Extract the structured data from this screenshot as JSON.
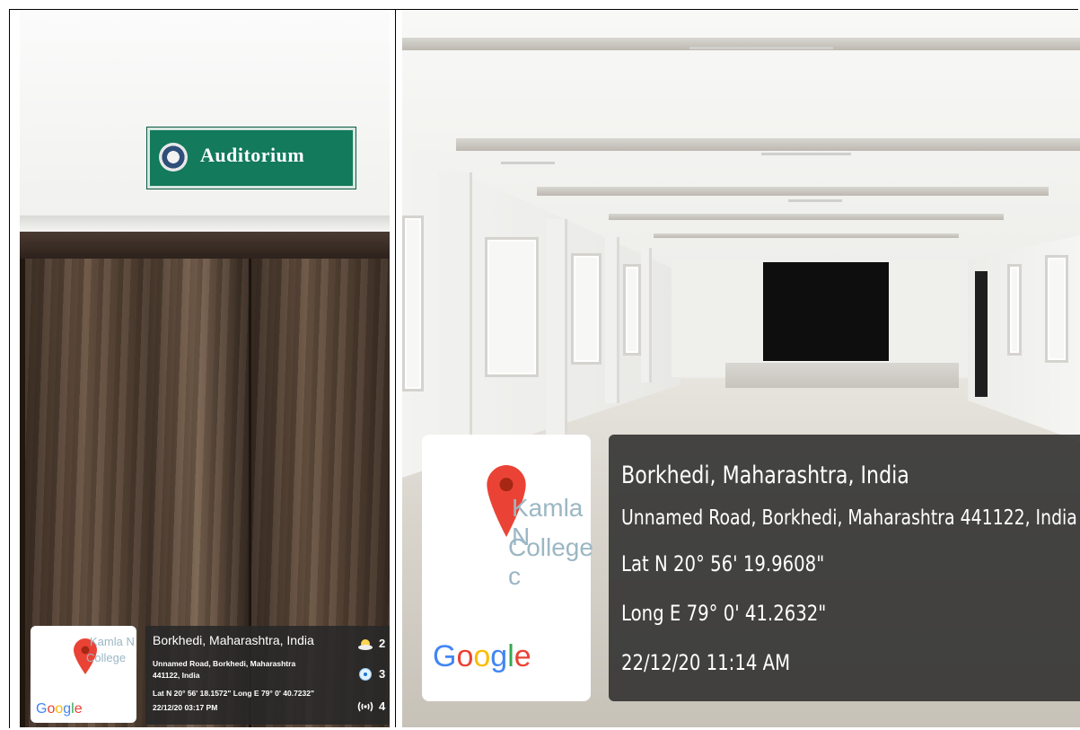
{
  "left_photo": {
    "sign_text": "Auditorium",
    "map_thumb": {
      "text_line1": "Kamla N",
      "text_line2": "College",
      "google": [
        "G",
        "o",
        "o",
        "g",
        "l",
        "e"
      ]
    },
    "info": {
      "title": "Borkhedi, Maharashtra, India",
      "address": "Unnamed Road, Borkhedi, Maharashtra 441122, India",
      "latlong": "Lat N 20° 56' 18.1572\" Long E 79° 0' 40.7232\"",
      "datetime": "22/12/20 03:17 PM",
      "weather": [
        {
          "icon": "cloud-sun-icon",
          "value": "2"
        },
        {
          "icon": "compass-icon",
          "value": "3"
        },
        {
          "icon": "wind-icon",
          "value": "4"
        }
      ]
    }
  },
  "right_photo": {
    "map_thumb": {
      "text_line1": "Kamla N",
      "text_line2": "College c",
      "google": [
        "G",
        "o",
        "o",
        "g",
        "l",
        "e"
      ]
    },
    "info": {
      "title": "Borkhedi, Maharashtra, India",
      "address": "Unnamed Road, Borkhedi, Maharashtra 441122, India",
      "lat": "Lat N 20° 56' 19.9608\"",
      "long": "Long E 79° 0' 41.2632\"",
      "datetime": "22/12/20 11:14 AM"
    }
  },
  "colors": {
    "sign_green": "#137a5c",
    "pin_red": "#ea4335",
    "overlay": "#2d2d2d"
  }
}
